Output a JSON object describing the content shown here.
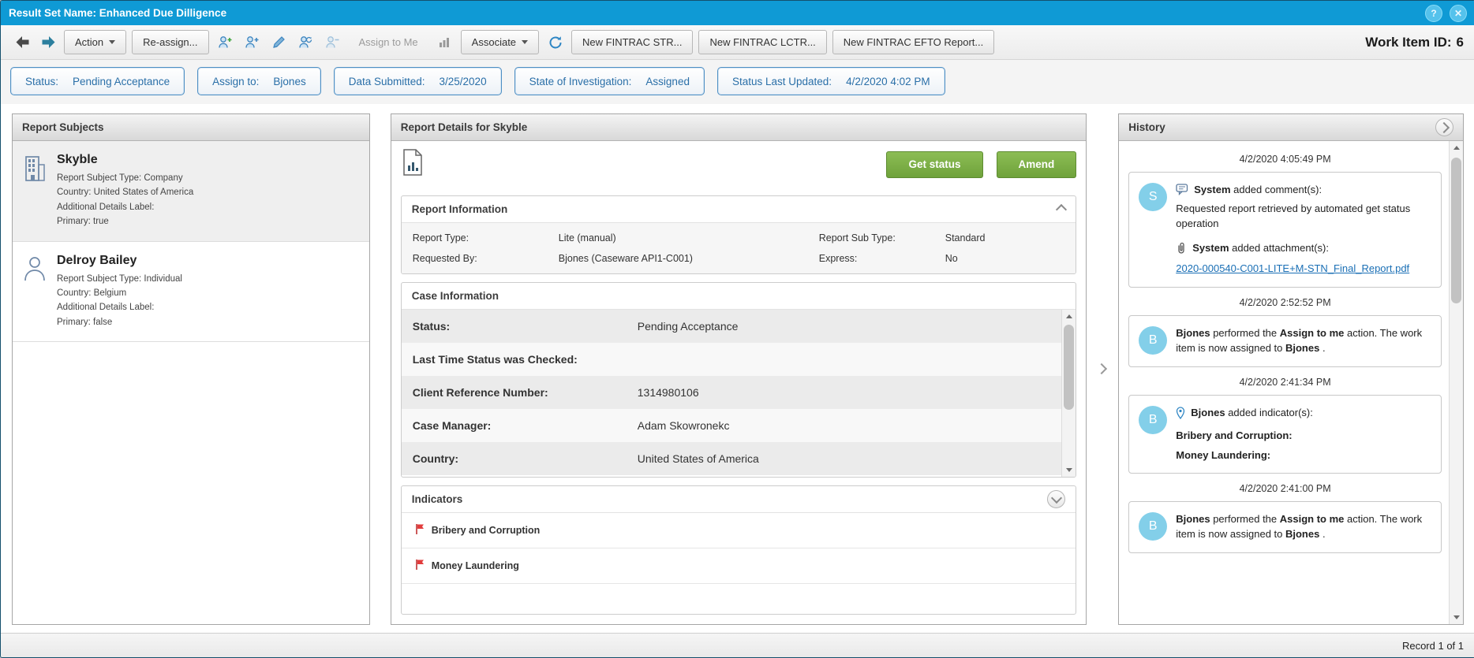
{
  "window": {
    "title": "Result Set Name: Enhanced Due Dilligence",
    "work_item_label": "Work Item ID:",
    "work_item_value": "6",
    "record_text": "Record 1 of 1"
  },
  "icons": {
    "help": "?",
    "close": "✕"
  },
  "toolbar": {
    "action": "Action",
    "reassign": "Re-assign...",
    "assign_to_me": "Assign to Me",
    "associate": "Associate",
    "new_str": "New FINTRAC STR...",
    "new_lctr": "New FINTRAC LCTR...",
    "new_efto": "New FINTRAC EFTO Report..."
  },
  "pills": [
    {
      "label": "Status:",
      "value": "Pending Acceptance"
    },
    {
      "label": "Assign to:",
      "value": "Bjones"
    },
    {
      "label": "Data Submitted:",
      "value": "3/25/2020"
    },
    {
      "label": "State of Investigation:",
      "value": "Assigned"
    },
    {
      "label": "Status Last Updated:",
      "value": "4/2/2020 4:02 PM"
    }
  ],
  "report_subjects": {
    "title": "Report Subjects",
    "subjects": [
      {
        "name": "Skyble",
        "details": [
          "Report Subject Type: Company",
          "Country: United States of America",
          "Additional Details Label:",
          "Primary: true"
        ]
      },
      {
        "name": "Delroy Bailey",
        "details": [
          "Report Subject Type: Individual",
          "Country: Belgium",
          "Additional Details Label:",
          "Primary: false"
        ]
      }
    ]
  },
  "report_details": {
    "title": "Report Details for Skyble",
    "get_status": "Get status",
    "amend": "Amend",
    "report_information": {
      "title": "Report Information",
      "fields": [
        {
          "label": "Report Type:",
          "value": "Lite (manual)"
        },
        {
          "label": "Report Sub Type:",
          "value": "Standard"
        },
        {
          "label": "Requested By:",
          "value": "Bjones (Caseware API1-C001)"
        },
        {
          "label": "Express:",
          "value": "No"
        }
      ]
    },
    "case_information": {
      "title": "Case Information",
      "rows": [
        {
          "label": "Status:",
          "value": "Pending Acceptance"
        },
        {
          "label": "Last Time Status was Checked:",
          "value": ""
        },
        {
          "label": "Client Reference Number:",
          "value": "1314980106"
        },
        {
          "label": "Case Manager:",
          "value": "Adam Skowronekc"
        },
        {
          "label": "Country:",
          "value": "United States of America"
        }
      ]
    },
    "indicators": {
      "title": "Indicators",
      "items": [
        "Bribery and Corruption",
        "Money Laundering"
      ]
    }
  },
  "history": {
    "title": "History",
    "entries": [
      {
        "timestamp": "4/2/2020 4:05:49 PM",
        "avatar": "S",
        "comment_actor": "System",
        "comment_label": " added comment(s):",
        "comment_body": "Requested report retrieved by automated get status operation",
        "attachment_actor": "System",
        "attachment_label": " added attachment(s):",
        "attachment_link": "2020-000540-C001-LITE+M-STN_Final_Report.pdf"
      },
      {
        "timestamp": "4/2/2020 2:52:52 PM",
        "avatar": "B",
        "actor": "Bjones",
        "part1": " performed the ",
        "action": "Assign to me",
        "part2": " action. The work item is now assigned to ",
        "target": "Bjones",
        "part3": " ."
      },
      {
        "timestamp": "4/2/2020 2:41:34 PM",
        "avatar": "B",
        "actor": "Bjones",
        "label": " added indicator(s):",
        "items": [
          "Bribery and Corruption:",
          "Money Laundering:"
        ]
      },
      {
        "timestamp": "4/2/2020 2:41:00 PM",
        "avatar": "B",
        "actor": "Bjones",
        "part1": " performed the ",
        "action": "Assign to me",
        "part2": " action. The work item is now assigned to ",
        "target": "Bjones",
        "part3": " ."
      }
    ]
  }
}
